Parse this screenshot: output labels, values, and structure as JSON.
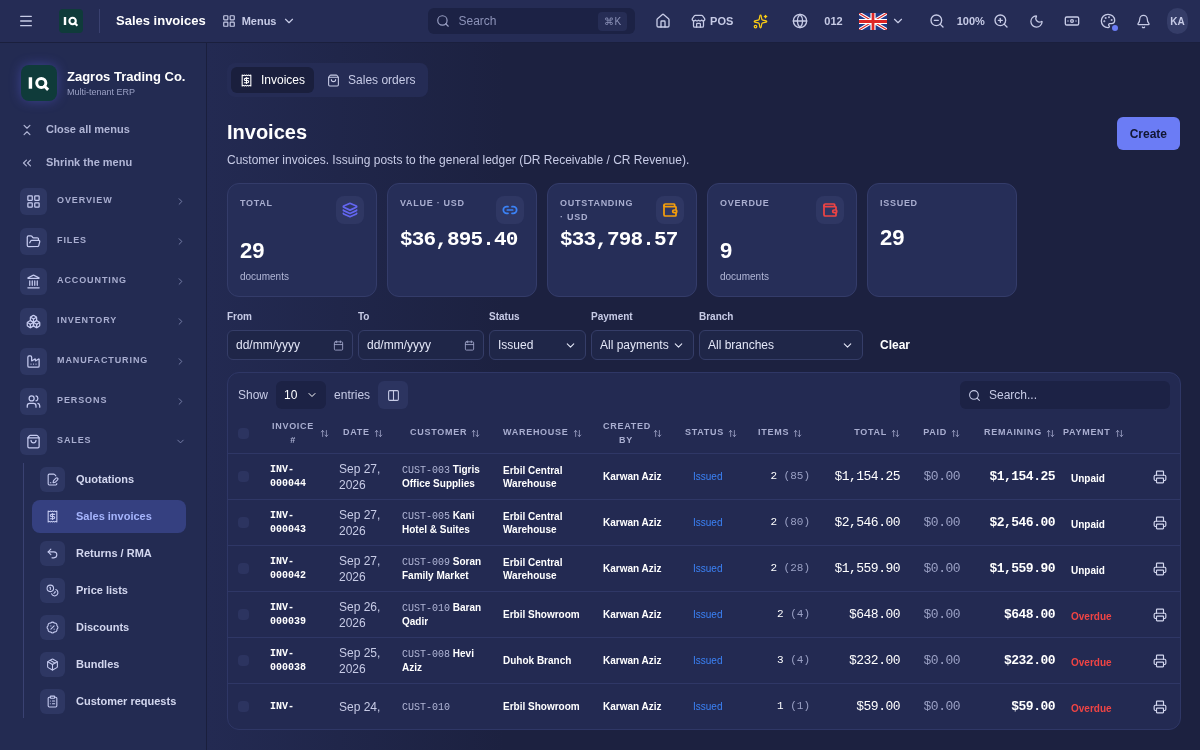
{
  "topbar": {
    "page_title": "Sales invoices",
    "menus_label": "Menus",
    "search_placeholder": "Search",
    "search_shortcut": "⌘K",
    "pos_label": "POS",
    "branch_code": "012",
    "zoom": "100%",
    "avatar": "KA"
  },
  "sidebar": {
    "company": {
      "name": "Zagros Trading Co.",
      "subtitle": "Multi-tenant ERP"
    },
    "actions": [
      {
        "label": "Close all menus"
      },
      {
        "label": "Shrink the menu"
      }
    ],
    "sections": [
      {
        "label": "OVERVIEW",
        "expanded": false
      },
      {
        "label": "FILES",
        "expanded": false
      },
      {
        "label": "ACCOUNTING",
        "expanded": false
      },
      {
        "label": "INVENTORY",
        "expanded": false
      },
      {
        "label": "MANUFACTURING",
        "expanded": false
      },
      {
        "label": "PERSONS",
        "expanded": false
      },
      {
        "label": "SALES",
        "expanded": true,
        "children": [
          {
            "label": "Quotations",
            "selected": false
          },
          {
            "label": "Sales invoices",
            "selected": true
          },
          {
            "label": "Returns / RMA",
            "selected": false
          },
          {
            "label": "Price lists",
            "selected": false
          },
          {
            "label": "Discounts",
            "selected": false
          },
          {
            "label": "Bundles",
            "selected": false
          },
          {
            "label": "Customer requests",
            "selected": false
          }
        ]
      }
    ]
  },
  "tabs": [
    {
      "label": "Invoices",
      "selected": true
    },
    {
      "label": "Sales orders",
      "selected": false
    }
  ],
  "header": {
    "title": "Invoices",
    "subtitle": "Customer invoices. Issuing posts to the general ledger (DR Receivable / CR Revenue).",
    "create_button": "Create"
  },
  "stats": [
    {
      "label": "TOTAL",
      "value": "29",
      "unit": "documents",
      "kind": "count",
      "color": "#6366f1"
    },
    {
      "label": "VALUE · USD",
      "value": "$36,895.40",
      "kind": "money",
      "color": "#3b82f6"
    },
    {
      "label": "OUTSTANDING · USD",
      "value": "$33,798.57",
      "kind": "money",
      "color": "#f59e0b"
    },
    {
      "label": "OVERDUE",
      "value": "9",
      "unit": "documents",
      "kind": "count",
      "color": "#ef4444"
    },
    {
      "label": "ISSUED",
      "value": "29",
      "kind": "count"
    }
  ],
  "filters": [
    {
      "label": "From",
      "kind": "date",
      "value": "dd/mm/yyyy"
    },
    {
      "label": "To",
      "kind": "date",
      "value": "dd/mm/yyyy"
    },
    {
      "label": "Status",
      "kind": "select",
      "value": "Issued"
    },
    {
      "label": "Payment",
      "kind": "select",
      "value": "All payments"
    },
    {
      "label": "Branch",
      "kind": "select",
      "value": "All branches"
    }
  ],
  "clear_button": "Clear",
  "table": {
    "show_label": "Show",
    "page_size": "10",
    "entries_label": "entries",
    "search_placeholder": "Search...",
    "all_checked": false,
    "columns": [
      "INVOICE #",
      "DATE",
      "CUSTOMER",
      "WAREHOUSE",
      "CREATED BY",
      "STATUS",
      "ITEMS",
      "TOTAL",
      "PAID",
      "REMAINING",
      "PAYMENT"
    ],
    "rows": [
      {
        "checked": false,
        "invoice": "INV-000044",
        "date": "Sep 27, 2026",
        "customer_code": "CUST-003",
        "customer_name": "Tigris Office Supplies",
        "warehouse": "Erbil Central Warehouse",
        "created_by": "Karwan Aziz",
        "status": "Issued",
        "items": "2",
        "items_qty": "(85)",
        "total": "$1,154.25",
        "paid": "$0.00",
        "remaining": "$1,154.25",
        "payment": {
          "label": "Unpaid",
          "color": "#ffffff"
        }
      },
      {
        "checked": false,
        "invoice": "INV-000043",
        "date": "Sep 27, 2026",
        "customer_code": "CUST-005",
        "customer_name": "Kani Hotel & Suites",
        "warehouse": "Erbil Central Warehouse",
        "created_by": "Karwan Aziz",
        "status": "Issued",
        "items": "2",
        "items_qty": "(80)",
        "total": "$2,546.00",
        "paid": "$0.00",
        "remaining": "$2,546.00",
        "payment": {
          "label": "Unpaid",
          "color": "#ffffff"
        }
      },
      {
        "checked": false,
        "invoice": "INV-000042",
        "date": "Sep 27, 2026",
        "customer_code": "CUST-009",
        "customer_name": "Soran Family Market",
        "warehouse": "Erbil Central Warehouse",
        "created_by": "Karwan Aziz",
        "status": "Issued",
        "items": "2",
        "items_qty": "(28)",
        "total": "$1,559.90",
        "paid": "$0.00",
        "remaining": "$1,559.90",
        "payment": {
          "label": "Unpaid",
          "color": "#ffffff"
        }
      },
      {
        "checked": false,
        "invoice": "INV-000039",
        "date": "Sep 26, 2026",
        "customer_code": "CUST-010",
        "customer_name": "Baran Qadir",
        "warehouse": "Erbil Showroom",
        "created_by": "Karwan Aziz",
        "status": "Issued",
        "items": "2",
        "items_qty": "(4)",
        "total": "$648.00",
        "paid": "$0.00",
        "remaining": "$648.00",
        "payment": {
          "label": "Overdue",
          "color": "#ef4444"
        }
      },
      {
        "checked": false,
        "invoice": "INV-000038",
        "date": "Sep 25, 2026",
        "customer_code": "CUST-008",
        "customer_name": "Hevi Aziz",
        "warehouse": "Duhok Branch",
        "created_by": "Karwan Aziz",
        "status": "Issued",
        "items": "3",
        "items_qty": "(4)",
        "total": "$232.00",
        "paid": "$0.00",
        "remaining": "$232.00",
        "payment": {
          "label": "Overdue",
          "color": "#ef4444"
        }
      },
      {
        "checked": false,
        "invoice": "INV-",
        "date": "Sep 24,",
        "customer_code": "CUST-010",
        "warehouse": "Erbil Showroom",
        "created_by": "Karwan Aziz",
        "status": "Issued",
        "items": "1",
        "items_qty": "(1)",
        "total": "$59.00",
        "paid": "$0.00",
        "remaining": "$59.00",
        "payment": {
          "label": "Overdue",
          "color": "#ef4444"
        }
      }
    ]
  }
}
